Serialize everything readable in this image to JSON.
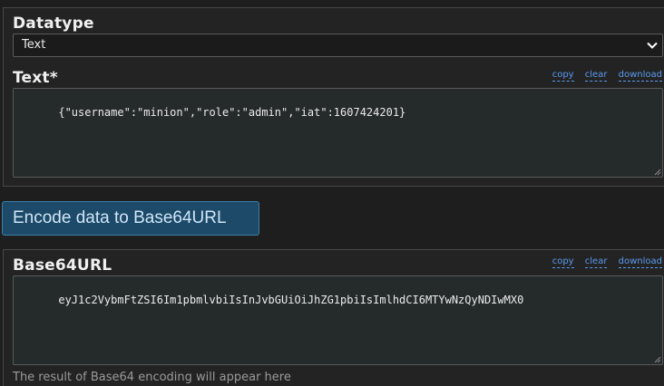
{
  "datatype_section": {
    "label": "Datatype",
    "selected": "Text"
  },
  "text_section": {
    "label": "Text*",
    "value": "{\"username\":\"minion\",\"role\":\"admin\",\"iat\":1607424201}",
    "tools": {
      "copy": "copy",
      "clear": "clear",
      "download": "download"
    }
  },
  "encode_button": {
    "label": "Encode data to Base64URL"
  },
  "output_section": {
    "label": "Base64URL",
    "value": "eyJ1c2VybmFtZSI6Im1pbmlvbiIsInJvbGUiOiJhZG1pbiIsImlhdCI6MTYwNzQyNDIwMX0",
    "hint": "The result of Base64 encoding will appear here",
    "tools": {
      "copy": "copy",
      "clear": "clear",
      "download": "download"
    }
  },
  "colors": {
    "background": "#1e1e1e",
    "panel": "#232323",
    "accent_link": "#5b9bf0",
    "button_bg": "#1d4a68",
    "button_text": "#cfe6f7"
  }
}
